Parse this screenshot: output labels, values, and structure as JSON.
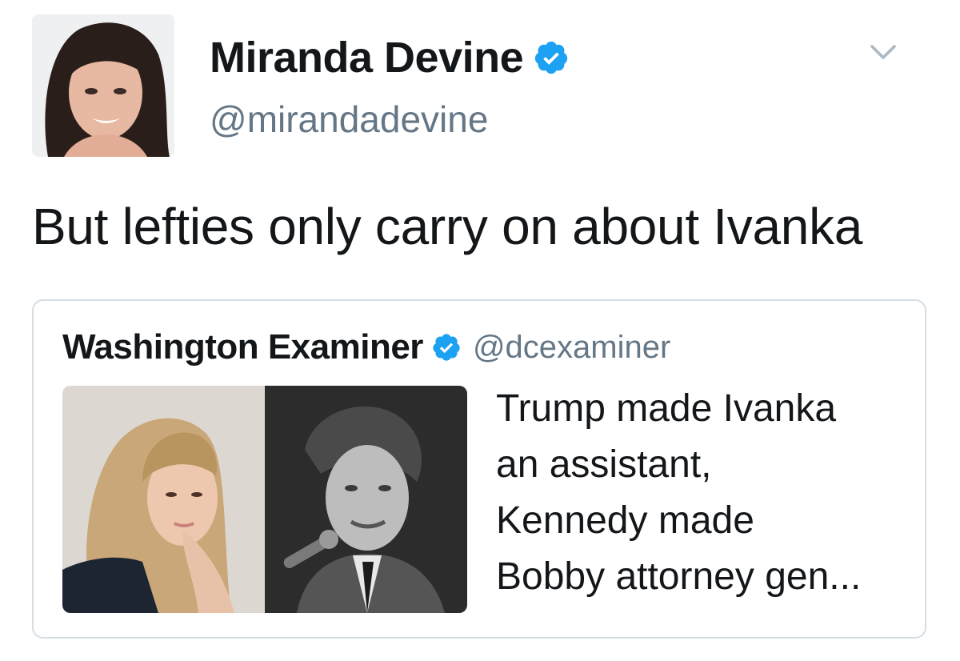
{
  "tweet": {
    "author": {
      "display_name": "Miranda Devine",
      "handle": "@mirandadevine",
      "verified": true
    },
    "menu_icon": "chevron-down-icon",
    "text": "But lefties only carry on about Ivanka",
    "quoted": {
      "author": {
        "display_name": "Washington Examiner",
        "handle": "@dcexaminer",
        "verified": true
      },
      "text_lines": [
        "Trump made Ivanka",
        "an assistant,",
        "Kennedy made",
        "Bobby attorney gen..."
      ]
    }
  },
  "colors": {
    "text": "#14171a",
    "muted": "#657786",
    "verified_blue": "#1da1f2",
    "card_border": "#d6dee4",
    "chevron": "#aab8c2"
  }
}
